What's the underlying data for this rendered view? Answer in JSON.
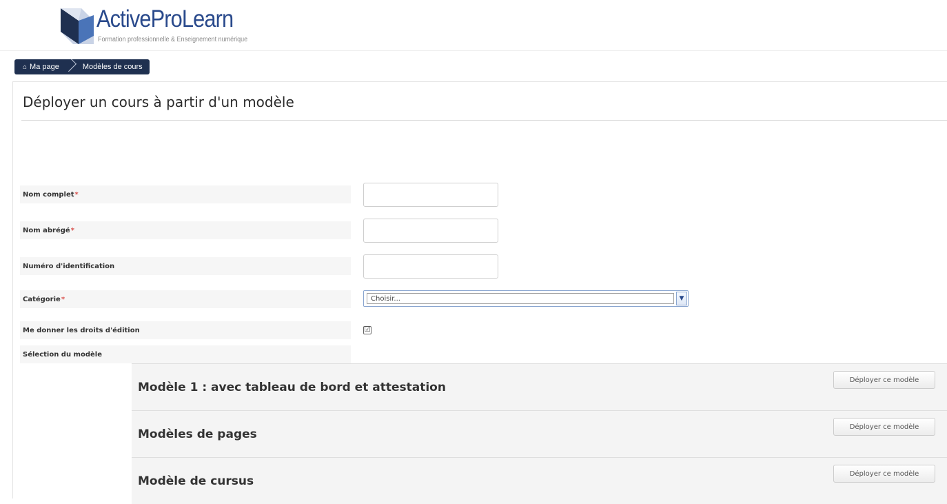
{
  "brand": {
    "name": "ActiveProLearn",
    "tagline": "Formation professionnelle & Enseignement numérique",
    "colors": {
      "primary": "#2a4a8c",
      "dark": "#1f3050",
      "accent": "#4a74b8"
    }
  },
  "breadcrumb": {
    "home_icon": "home-icon",
    "items": [
      {
        "label": "Ma page"
      },
      {
        "label": "Modèles de cours"
      }
    ]
  },
  "page": {
    "title": "Déployer un cours à partir d'un modèle"
  },
  "form": {
    "full_name": {
      "label": "Nom complet",
      "required_mark": "*",
      "value": ""
    },
    "short_name": {
      "label": "Nom abrégé",
      "required_mark": "*",
      "value": ""
    },
    "id_number": {
      "label": "Numéro d'identification",
      "value": ""
    },
    "category": {
      "label": "Catégorie",
      "required_mark": "*",
      "selected": "Choisir..."
    },
    "edit_rights": {
      "label": "Me donner les droits d'édition",
      "checked": true,
      "check_glyph": "☑"
    },
    "template_selection": {
      "label": "Sélection du modèle"
    }
  },
  "templates": [
    {
      "title": "Modèle 1 : avec tableau de bord et attestation",
      "button_label": "Déployer ce modèle"
    },
    {
      "title": "Modèles de pages",
      "button_label": "Déployer ce modèle"
    },
    {
      "title": "Modèle de cursus",
      "button_label": "Déployer ce modèle"
    }
  ]
}
